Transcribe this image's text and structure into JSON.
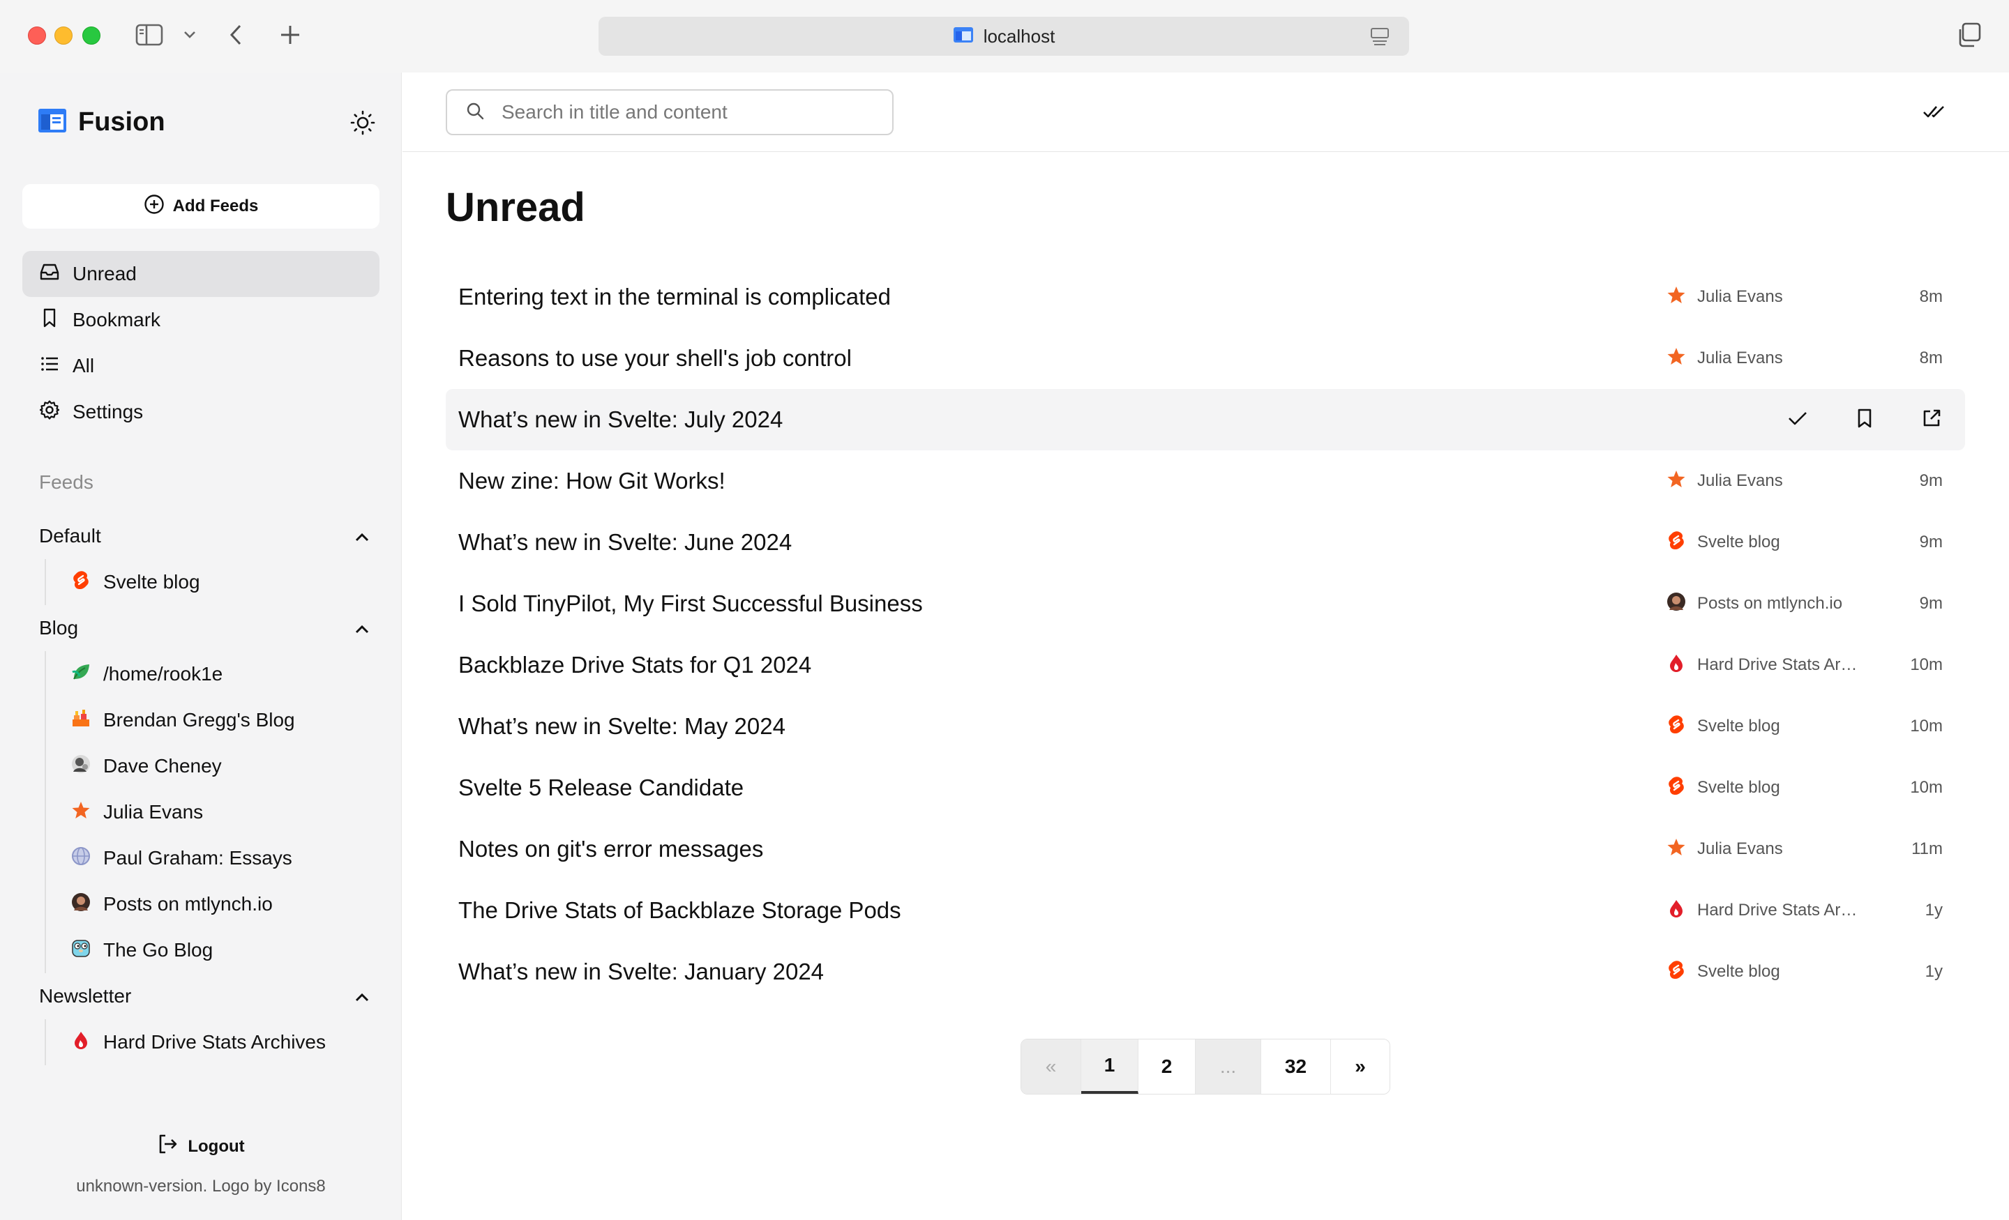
{
  "browser": {
    "address": "localhost"
  },
  "sidebar": {
    "app_name": "Fusion",
    "add_feeds_label": "Add Feeds",
    "nav": [
      {
        "label": "Unread",
        "icon": "inbox-icon",
        "active": true
      },
      {
        "label": "Bookmark",
        "icon": "bookmark-icon",
        "active": false
      },
      {
        "label": "All",
        "icon": "list-icon",
        "active": false
      },
      {
        "label": "Settings",
        "icon": "gear-icon",
        "active": false
      }
    ],
    "feeds_heading": "Feeds",
    "groups": [
      {
        "name": "Default",
        "feeds": [
          {
            "name": "Svelte blog",
            "icon": "svelte-icon"
          }
        ]
      },
      {
        "name": "Blog",
        "feeds": [
          {
            "name": "/home/rook1e",
            "icon": "leaf-icon"
          },
          {
            "name": "Brendan Gregg's Blog",
            "icon": "flame-icon"
          },
          {
            "name": "Dave Cheney",
            "icon": "avatar-icon"
          },
          {
            "name": "Julia Evans",
            "icon": "star-icon"
          },
          {
            "name": "Paul Graham: Essays",
            "icon": "globe-icon"
          },
          {
            "name": "Posts on mtlynch.io",
            "icon": "avatar-icon"
          },
          {
            "name": "The Go Blog",
            "icon": "gopher-icon"
          }
        ]
      },
      {
        "name": "Newsletter",
        "feeds": [
          {
            "name": "Hard Drive Stats Archives",
            "icon": "backblaze-icon"
          }
        ]
      }
    ],
    "logout_label": "Logout",
    "version_text": "unknown-version. Logo by Icons8"
  },
  "main": {
    "search_placeholder": "Search in title and content",
    "title": "Unread",
    "items": [
      {
        "title": "Entering text in the terminal is complicated",
        "source": "Julia Evans",
        "source_icon": "star-icon",
        "time": "8m"
      },
      {
        "title": "Reasons to use your shell's job control",
        "source": "Julia Evans",
        "source_icon": "star-icon",
        "time": "8m"
      },
      {
        "title": "What’s new in Svelte: July 2024",
        "source": "",
        "source_icon": "",
        "time": "",
        "hovered": true
      },
      {
        "title": "New zine: How Git Works!",
        "source": "Julia Evans",
        "source_icon": "star-icon",
        "time": "9m"
      },
      {
        "title": "What’s new in Svelte: June 2024",
        "source": "Svelte blog",
        "source_icon": "svelte-icon",
        "time": "9m"
      },
      {
        "title": "I Sold TinyPilot, My First Successful Business",
        "source": "Posts on mtlynch.io",
        "source_icon": "avatar-icon",
        "time": "9m"
      },
      {
        "title": "Backblaze Drive Stats for Q1 2024",
        "source": "Hard Drive Stats Archives",
        "source_icon": "backblaze-icon",
        "time": "10m"
      },
      {
        "title": "What’s new in Svelte: May 2024",
        "source": "Svelte blog",
        "source_icon": "svelte-icon",
        "time": "10m"
      },
      {
        "title": "Svelte 5 Release Candidate",
        "source": "Svelte blog",
        "source_icon": "svelte-icon",
        "time": "10m"
      },
      {
        "title": "Notes on git's error messages",
        "source": "Julia Evans",
        "source_icon": "star-icon",
        "time": "11m"
      },
      {
        "title": "The Drive Stats of Backblaze Storage Pods",
        "source": "Hard Drive Stats Archives",
        "source_icon": "backblaze-icon",
        "time": "1y"
      },
      {
        "title": "What’s new in Svelte: January 2024",
        "source": "Svelte blog",
        "source_icon": "svelte-icon",
        "time": "1y"
      }
    ],
    "pagination": [
      {
        "label": "«",
        "state": "disabled"
      },
      {
        "label": "1",
        "state": "current"
      },
      {
        "label": "2",
        "state": "normal"
      },
      {
        "label": "...",
        "state": "disabled"
      },
      {
        "label": "32",
        "state": "normal"
      },
      {
        "label": "»",
        "state": "normal"
      }
    ]
  },
  "colors": {
    "accent_orange": "#f05a22",
    "svelte_orange": "#ff3e00",
    "backblaze_red": "#e21e29",
    "sidebar_bg": "#f4f4f5"
  }
}
